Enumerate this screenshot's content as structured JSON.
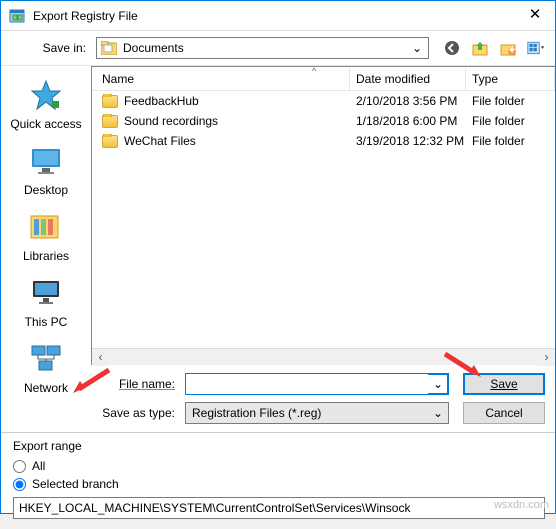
{
  "dialog": {
    "title": "Export Registry File",
    "save_in_label": "Save in:",
    "save_in_value": "Documents"
  },
  "places": {
    "quick_access": "Quick access",
    "desktop": "Desktop",
    "libraries": "Libraries",
    "this_pc": "This PC",
    "network": "Network"
  },
  "columns": {
    "name": "Name",
    "date": "Date modified",
    "type": "Type"
  },
  "files": [
    {
      "name": "FeedbackHub",
      "date": "2/10/2018 3:56 PM",
      "type": "File folder"
    },
    {
      "name": "Sound recordings",
      "date": "1/18/2018 6:00 PM",
      "type": "File folder"
    },
    {
      "name": "WeChat Files",
      "date": "3/19/2018 12:32 PM",
      "type": "File folder"
    }
  ],
  "fields": {
    "file_name_label": "File name:",
    "file_name_value": "",
    "save_as_type_label": "Save as type:",
    "save_as_type_value": "Registration Files (*.reg)"
  },
  "buttons": {
    "save": "Save",
    "cancel": "Cancel"
  },
  "export_range": {
    "group_label": "Export range",
    "all_label": "All",
    "selected_label": "Selected branch",
    "selected_value": "HKEY_LOCAL_MACHINE\\SYSTEM\\CurrentControlSet\\Services\\Winsock"
  },
  "watermark": "wsxdn.com"
}
